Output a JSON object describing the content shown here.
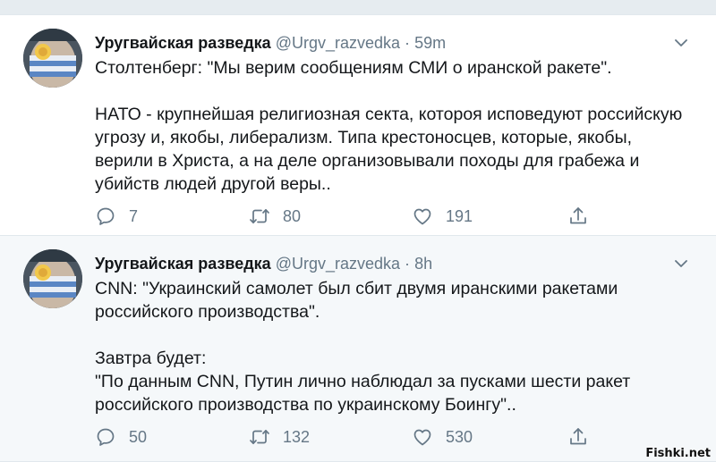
{
  "tweets": [
    {
      "author_name": "Уругвайская разведка",
      "handle": "@Urgv_razvedka",
      "separator": "·",
      "time": "59m",
      "lines": [
        "Столтенберг: \"Мы верим сообщениям СМИ о иранской ракете\".",
        "",
        "НАТО - крупнейшая религиозная секта, котороя исповедуют российскую",
        "угрозу и, якобы, либерализм. Типа крестоносцев, которые, якобы,",
        "верили в Христа, а на деле организовывали походы для грабежа и",
        "убийств людей другой веры.."
      ],
      "replies": "7",
      "retweets": "80",
      "likes": "191"
    },
    {
      "author_name": "Уругвайская разведка",
      "handle": "@Urgv_razvedka",
      "separator": "·",
      "time": "8h",
      "lines": [
        "CNN: \"Украинский самолет был сбит двумя иранскими ракетами",
        "российского производства\".",
        "",
        "Завтра будет:",
        "\"По данным CNN, Путин лично наблюдал за пусками шести ракет",
        "российского производства по украинскому Боингу\".."
      ],
      "replies": "50",
      "retweets": "132",
      "likes": "530"
    }
  ],
  "icons": {
    "reply": "reply-icon",
    "retweet": "retweet-icon",
    "like": "heart-icon",
    "share": "share-icon",
    "menu": "chevron-down-icon"
  },
  "colors": {
    "secondary_text": "#657786",
    "divider": "#e1e8ed",
    "highlight_bg": "#f5f8fa"
  },
  "watermark": "Fishki.net"
}
